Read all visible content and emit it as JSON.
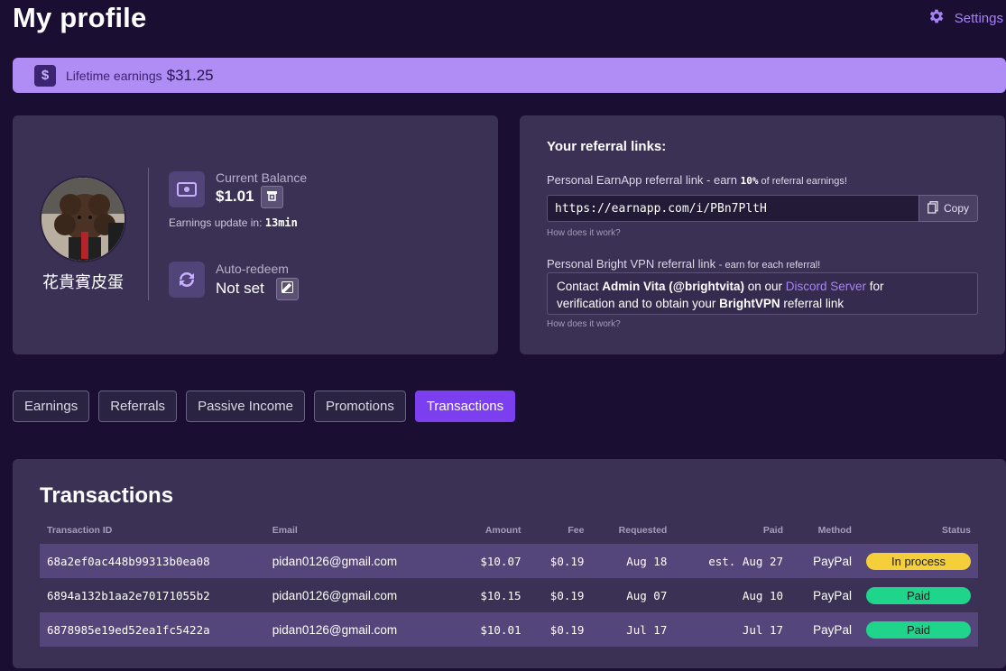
{
  "header": {
    "title": "My profile",
    "settings_label": "Settings"
  },
  "lifetime": {
    "label": "Lifetime earnings",
    "value": "$31.25",
    "icon": "dollar-icon",
    "icon_glyph": "$"
  },
  "profile": {
    "username": "花貴賓皮蛋",
    "balance_label": "Current Balance",
    "balance_value": "$1.01",
    "update_label": "Earnings update in:",
    "update_value": "13min",
    "autoredeem_label": "Auto-redeem",
    "autoredeem_value": "Not set"
  },
  "referral": {
    "title": "Your referral links:",
    "earnapp_prefix": "Personal EarnApp referral link - earn ",
    "earnapp_percent": "10%",
    "earnapp_suffix": " of referral earnings!",
    "link": "https://earnapp.com/i/PBn7PltH",
    "copy_label": "Copy",
    "how_label": "How does it work?",
    "vpn_prefix": "Personal Bright VPN referral link ",
    "vpn_suffix": "- earn for each referral!",
    "vpn_contact": "Contact ",
    "vpn_admin": "Admin Vita (@brightvita)",
    "vpn_on_our": " on our ",
    "vpn_discord": "Discord Server",
    "vpn_for": " for",
    "vpn_line2a": "verification and to obtain your ",
    "vpn_brightvpn": "BrightVPN",
    "vpn_line2b": " referral link",
    "how_label2": "How does it work?"
  },
  "tabs": [
    "Earnings",
    "Referrals",
    "Passive Income",
    "Promotions",
    "Transactions"
  ],
  "transactions": {
    "title": "Transactions",
    "columns": [
      "Transaction ID",
      "Email",
      "Amount",
      "Fee",
      "Requested",
      "Paid",
      "Method",
      "Status"
    ],
    "rows": [
      {
        "id": "68a2ef0ac448b99313b0ea08",
        "email": "pidan0126@gmail.com",
        "amount": "$10.07",
        "fee": "$0.19",
        "requested": "Aug 18",
        "paid": "est. Aug 27",
        "method": "PayPal",
        "status": "In process",
        "status_color": "#f5cf3a"
      },
      {
        "id": "6894a132b1aa2e70171055b2",
        "email": "pidan0126@gmail.com",
        "amount": "$10.15",
        "fee": "$0.19",
        "requested": "Aug 07",
        "paid": "Aug 10",
        "method": "PayPal",
        "status": "Paid",
        "status_color": "#1fd58c"
      },
      {
        "id": "6878985e19ed52ea1fc5422a",
        "email": "pidan0126@gmail.com",
        "amount": "$10.01",
        "fee": "$0.19",
        "requested": "Jul 17",
        "paid": "Jul 17",
        "method": "PayPal",
        "status": "Paid",
        "status_color": "#1fd58c"
      }
    ]
  },
  "colors": {
    "background": "#1a0f33",
    "accent": "#7b3ff0",
    "banner": "#b08cf5",
    "card": "#3b3155"
  }
}
